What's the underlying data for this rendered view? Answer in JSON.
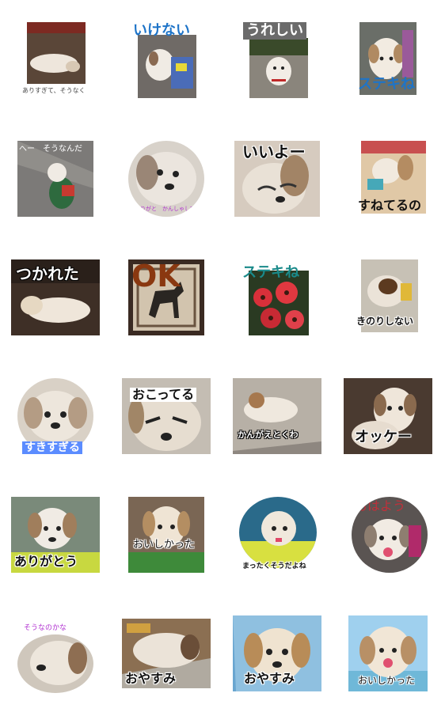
{
  "stickers": [
    {
      "caption": "ありすぎて、そうなく",
      "color": "#444444"
    },
    {
      "caption": "いけない",
      "color": "#1e74c8"
    },
    {
      "caption": "うれしい",
      "color": "#ffffff"
    },
    {
      "caption": "ステキね",
      "color": "#1e74c8"
    },
    {
      "caption": "へー　そうなんだ",
      "color": "#ffffff"
    },
    {
      "caption": "ありがと　かんしゃしてる",
      "color": "#b030d0"
    },
    {
      "caption": "いいよー",
      "color": "#111111"
    },
    {
      "caption": "すねてるの",
      "color": "#111111"
    },
    {
      "caption": "つかれた",
      "color": "#ffffff"
    },
    {
      "caption": "OK",
      "color": "#8a3810"
    },
    {
      "caption": "ステキね",
      "color": "#1a8a8a"
    },
    {
      "caption": "きのりしない",
      "color": "#111111"
    },
    {
      "caption": "すきすぎる",
      "color": "#ffffff"
    },
    {
      "caption": "おこってる",
      "color": "#111111"
    },
    {
      "caption": "かんがえとくわ",
      "color": "#ffffff"
    },
    {
      "caption": "オッケー",
      "color": "#111111"
    },
    {
      "caption": "ありがとう",
      "color": "#111111"
    },
    {
      "caption": "おいしかった",
      "color": "#111111"
    },
    {
      "caption": "まったくそうだよね",
      "color": "#111111"
    },
    {
      "caption": "おはよう",
      "color": "#c0303a"
    },
    {
      "caption": "そうなのかな",
      "color": "#b030d0"
    },
    {
      "caption": "おやすみ",
      "color": "#111111"
    },
    {
      "caption": "おやすみ",
      "color": "#111111"
    },
    {
      "caption": "おいしかった",
      "color": "#111111"
    }
  ]
}
